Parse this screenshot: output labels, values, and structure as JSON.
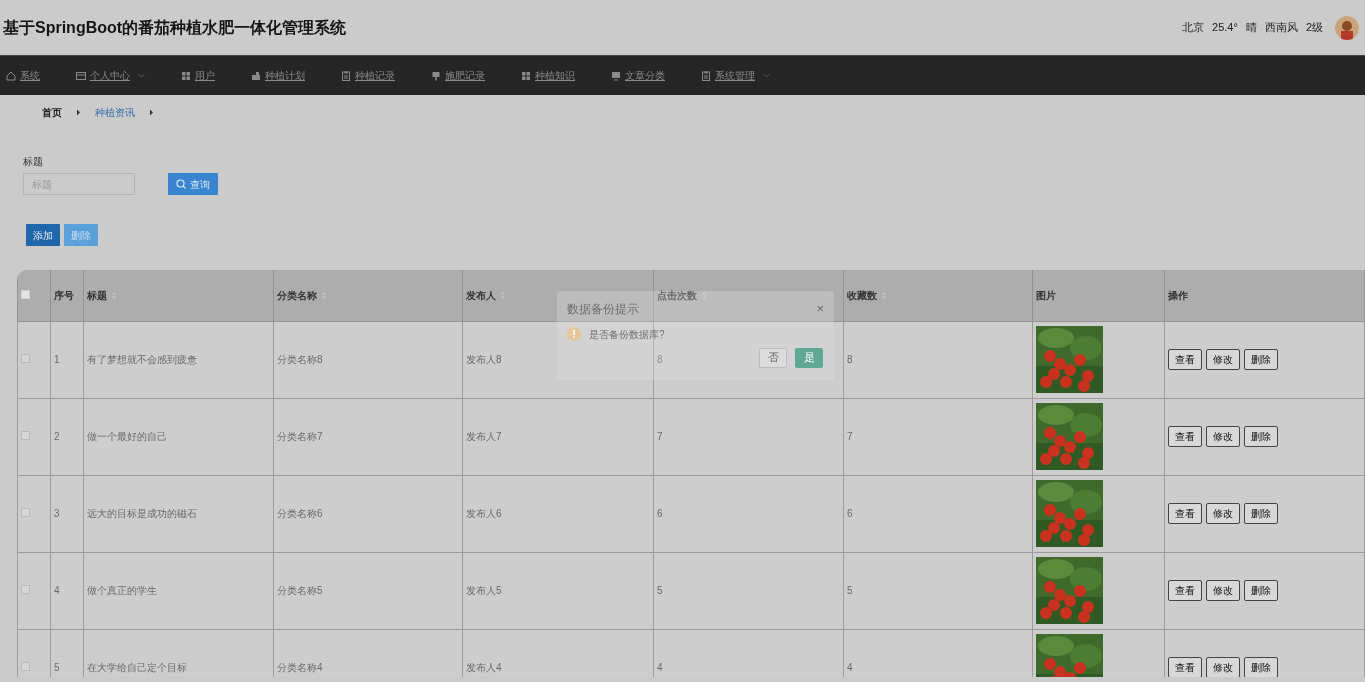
{
  "header": {
    "title": "基于SpringBoot的番茄种植水肥一体化管理系统",
    "weather": [
      "北京",
      "25.4°",
      "晴",
      "西南风",
      "2级"
    ]
  },
  "nav": [
    {
      "label": "系统",
      "kind": "home",
      "dropdown": false
    },
    {
      "label": "个人中心",
      "kind": "card",
      "dropdown": true
    },
    {
      "label": "用户",
      "kind": "grid",
      "dropdown": false
    },
    {
      "label": "种植计划",
      "kind": "plan",
      "dropdown": false
    },
    {
      "label": "种植记录",
      "kind": "clipboard",
      "dropdown": false
    },
    {
      "label": "施肥记录",
      "kind": "pin",
      "dropdown": false
    },
    {
      "label": "种植知识",
      "kind": "grid",
      "dropdown": false
    },
    {
      "label": "文章分类",
      "kind": "monitor",
      "dropdown": false
    },
    {
      "label": "系统管理",
      "kind": "clipboard",
      "dropdown": true
    }
  ],
  "breadcrumb": [
    {
      "label": "首页",
      "link": false
    },
    {
      "label": "种植资讯",
      "link": true
    }
  ],
  "search": {
    "label": "标题",
    "placeholder": "标题",
    "button": "查询"
  },
  "actions": [
    {
      "label": "添加",
      "kind": "primary"
    },
    {
      "label": "删除",
      "kind": "light"
    }
  ],
  "table": {
    "select_all_checked": false,
    "columns": [
      {
        "label": "序号",
        "sortable": false
      },
      {
        "label": "标题",
        "sortable": true
      },
      {
        "label": "分类名称",
        "sortable": true
      },
      {
        "label": "发布人",
        "sortable": true
      },
      {
        "label": "点击次数",
        "sortable": true
      },
      {
        "label": "收藏数",
        "sortable": true
      },
      {
        "label": "图片",
        "sortable": false
      },
      {
        "label": "操作",
        "sortable": false
      }
    ],
    "rows": [
      {
        "checked": false,
        "cells": [
          "1",
          "有了梦想就不会感到疲惫",
          "分类名称8",
          "发布人8",
          "8",
          "8"
        ],
        "buttons": [
          "查看",
          "修改",
          "删除"
        ]
      },
      {
        "checked": false,
        "cells": [
          "2",
          "做一个最好的自己",
          "分类名称7",
          "发布人7",
          "7",
          "7"
        ],
        "buttons": [
          "查看",
          "修改",
          "删除"
        ]
      },
      {
        "checked": false,
        "cells": [
          "3",
          "远大的目标是成功的磁石",
          "分类名称6",
          "发布人6",
          "6",
          "6"
        ],
        "buttons": [
          "查看",
          "修改",
          "删除"
        ]
      },
      {
        "checked": false,
        "cells": [
          "4",
          "做个真正的学生",
          "分类名称5",
          "发布人5",
          "5",
          "5"
        ],
        "buttons": [
          "查看",
          "修改",
          "删除"
        ]
      },
      {
        "checked": false,
        "cells": [
          "5",
          "在大学给自己定个目标",
          "分类名称4",
          "发布人4",
          "4",
          "4"
        ],
        "buttons": [
          "查看",
          "修改",
          "删除"
        ]
      }
    ]
  },
  "dialog": {
    "title": "数据备份提示",
    "close": "×",
    "message": "是否备份数据库?",
    "buttons": [
      {
        "label": "否",
        "kind": "cancel"
      },
      {
        "label": "是",
        "kind": "confirm"
      }
    ]
  }
}
